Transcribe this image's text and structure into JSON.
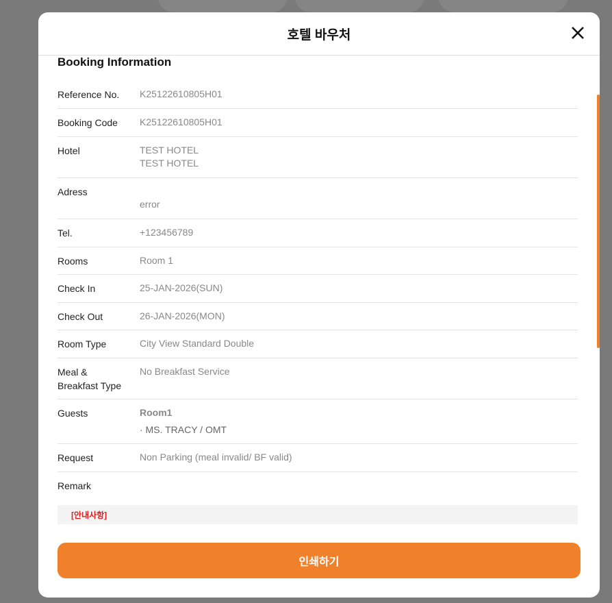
{
  "modal": {
    "title": "호텔 바우처",
    "section_title": "Booking Information",
    "print_label": "인쇄하기",
    "notice_label": "[안내사항]"
  },
  "rows": [
    {
      "label": "Reference No.",
      "value": "K25122610805H01"
    },
    {
      "label": "Booking Code",
      "value": "K25122610805H01"
    },
    {
      "label": "Hotel",
      "value": "TEST HOTEL",
      "value2": "TEST HOTEL"
    },
    {
      "label": "Adress",
      "value": "",
      "value2": "error"
    },
    {
      "label": "Tel.",
      "value": "+123456789"
    },
    {
      "label": "Rooms",
      "value": "Room 1"
    },
    {
      "label": "Check In",
      "value": "25-JAN-2026(SUN)"
    },
    {
      "label": "Check Out",
      "value": "26-JAN-2026(MON)"
    },
    {
      "label": "Room Type",
      "value": "City View Standard Double"
    },
    {
      "label": "Meal &",
      "label2": "Breakfast Type",
      "value": "No Breakfast Service"
    },
    {
      "label": "Guests",
      "value": "Room1",
      "value2": "· MS. TRACY / OMT"
    },
    {
      "label": "Request",
      "value": "Non Parking (meal invalid/ BF valid)"
    },
    {
      "label": "Remark",
      "value": ""
    }
  ],
  "colors": {
    "accent": "#f0812a",
    "notice": "#e41a1a"
  }
}
